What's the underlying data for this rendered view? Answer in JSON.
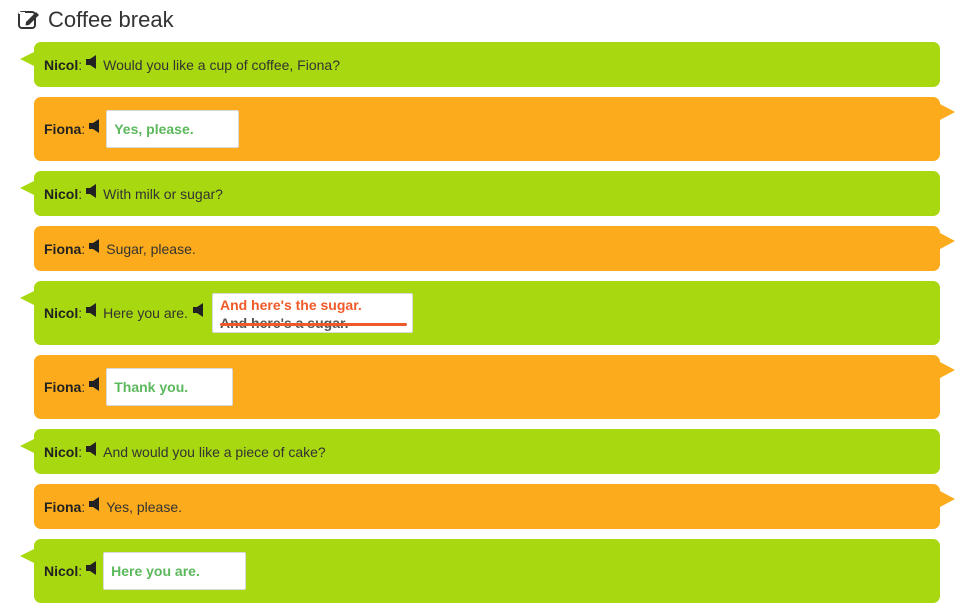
{
  "header": {
    "title": "Coffee break",
    "icon": "edit-icon"
  },
  "colors": {
    "nicol_bubble": "#a8d80f",
    "fiona_bubble": "#fbab1b",
    "correct_answer": "#5cb85c",
    "correction": "#f05a28"
  },
  "dialogue": [
    {
      "speaker": "Nicol",
      "text": "Would you like a cup of coffee, Fiona?"
    },
    {
      "speaker": "Fiona",
      "answer": "Yes, please."
    },
    {
      "speaker": "Nicol",
      "text": "With milk or sugar?"
    },
    {
      "speaker": "Fiona",
      "text": "Sugar, please."
    },
    {
      "speaker": "Nicol",
      "text": "Here you are.",
      "correct_answer": "And here's the sugar.",
      "wrong_answer": "And here's a sugar."
    },
    {
      "speaker": "Fiona",
      "answer": "Thank you."
    },
    {
      "speaker": "Nicol",
      "text": "And would you like a piece of cake?"
    },
    {
      "speaker": "Fiona",
      "text": "Yes, please."
    },
    {
      "speaker": "Nicol",
      "answer": "Here you are."
    }
  ],
  "colon": ":"
}
